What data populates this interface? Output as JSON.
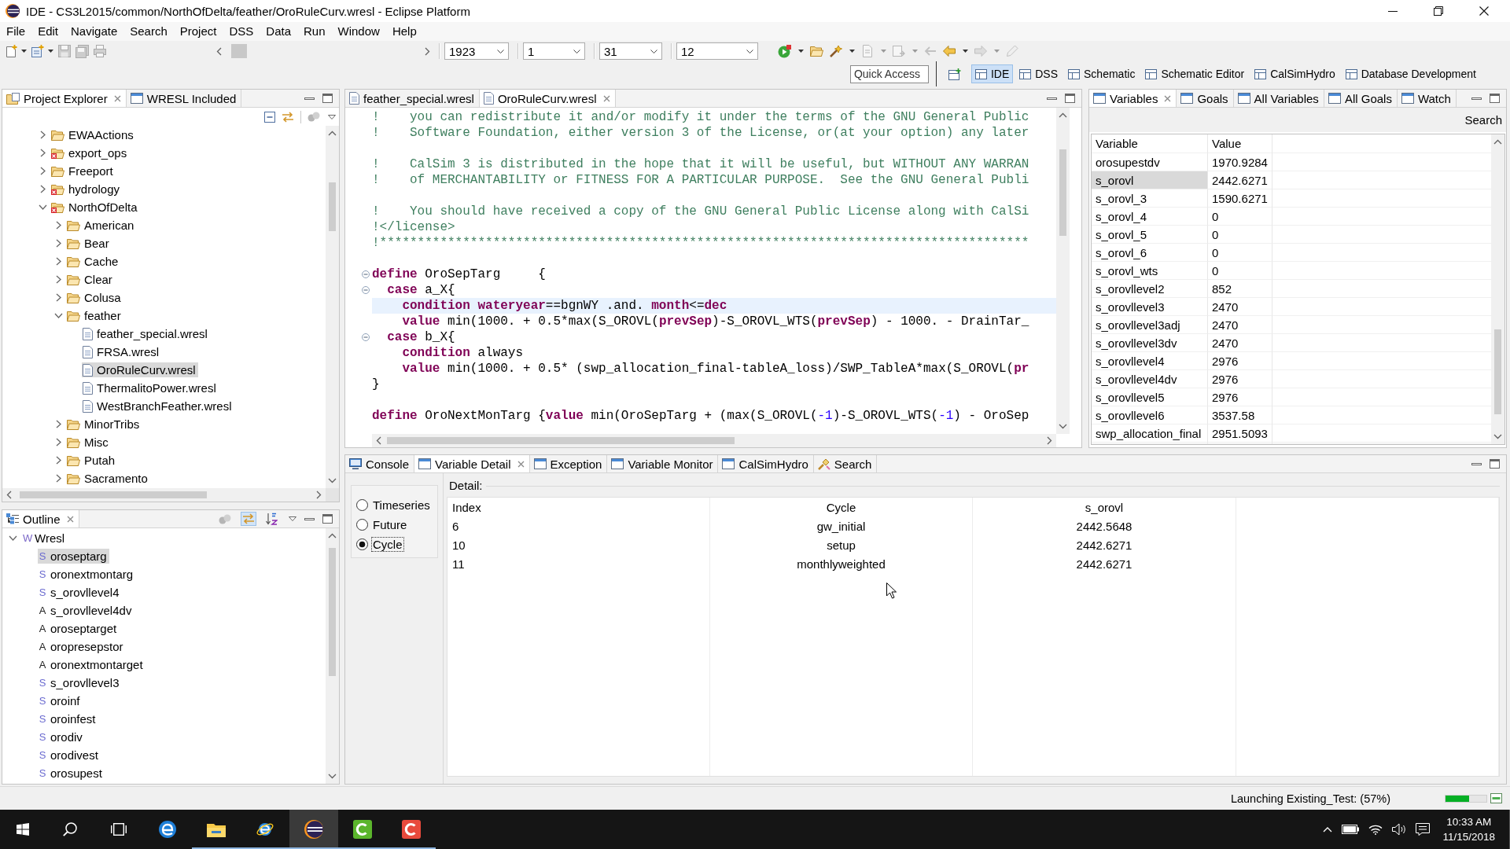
{
  "window": {
    "title": "IDE - CS3L2015/common/NorthOfDelta/feather/OroRuleCurv.wresl - Eclipse Platform"
  },
  "menu_bar": [
    "File",
    "Edit",
    "Navigate",
    "Search",
    "Project",
    "DSS",
    "Data",
    "Run",
    "Window",
    "Help"
  ],
  "toolbar": {
    "left_buttons": [
      {
        "disabled": false,
        "dropdown": true
      },
      {
        "disabled": false,
        "dropdown": true
      },
      {
        "disabled": true,
        "dropdown": false
      },
      {
        "disabled": true,
        "dropdown": false
      },
      {
        "disabled": true,
        "dropdown": false
      }
    ],
    "date_fields": [
      {
        "value": "1923"
      },
      {
        "value": "1"
      },
      {
        "value": "31"
      },
      {
        "value": "12"
      }
    ],
    "right_buttons": [
      {
        "disabled": false,
        "dropdown": true
      },
      {
        "disabled": false,
        "dropdown": false
      },
      {
        "disabled": false,
        "dropdown": true
      },
      {
        "disabled": true,
        "dropdown": true
      },
      {
        "disabled": true,
        "dropdown": true
      },
      {
        "disabled": true,
        "dropdown": false
      },
      {
        "disabled": false,
        "dropdown": true
      },
      {
        "disabled": true,
        "dropdown": true
      },
      {
        "disabled": true,
        "dropdown": false
      }
    ]
  },
  "quick_access": {
    "placeholder": "Quick Access"
  },
  "perspectives": [
    {
      "label": "IDE",
      "selected": true
    },
    {
      "label": "DSS",
      "selected": false
    },
    {
      "label": "Schematic",
      "selected": false
    },
    {
      "label": "Schematic Editor",
      "selected": false
    },
    {
      "label": "CalSimHydro",
      "selected": false
    },
    {
      "label": "Database Development",
      "selected": false
    }
  ],
  "project_explorer": {
    "tabs": [
      {
        "label": "Project Explorer",
        "selected": true
      },
      {
        "label": "WRESL Included",
        "selected": false
      }
    ],
    "tree": [
      {
        "label": "EWAActions",
        "kind": "folder",
        "expanded": false,
        "error": false,
        "selected": false
      },
      {
        "label": "export_ops",
        "kind": "folder",
        "expanded": false,
        "error": true,
        "selected": false
      },
      {
        "label": "Freeport",
        "kind": "folder",
        "expanded": false,
        "error": false,
        "selected": false
      },
      {
        "label": "hydrology",
        "kind": "folder",
        "expanded": false,
        "error": true,
        "selected": false
      },
      {
        "label": "NorthOfDelta",
        "kind": "folder",
        "expanded": true,
        "error": true,
        "selected": false,
        "children": [
          {
            "label": "American",
            "kind": "folder",
            "expanded": false,
            "error": false,
            "selected": false
          },
          {
            "label": "Bear",
            "kind": "folder",
            "expanded": false,
            "error": false,
            "selected": false
          },
          {
            "label": "Cache",
            "kind": "folder",
            "expanded": false,
            "error": false,
            "selected": false
          },
          {
            "label": "Clear",
            "kind": "folder",
            "expanded": false,
            "error": false,
            "selected": false
          },
          {
            "label": "Colusa",
            "kind": "folder",
            "expanded": false,
            "error": false,
            "selected": false
          },
          {
            "label": "feather",
            "kind": "folder",
            "expanded": true,
            "error": false,
            "selected": false,
            "children": [
              {
                "label": "feather_special.wresl",
                "kind": "file",
                "selected": false
              },
              {
                "label": "FRSA.wresl",
                "kind": "file",
                "selected": false
              },
              {
                "label": "OroRuleCurv.wresl",
                "kind": "file",
                "selected": true
              },
              {
                "label": "ThermalitoPower.wresl",
                "kind": "file",
                "selected": false
              },
              {
                "label": "WestBranchFeather.wresl",
                "kind": "file",
                "selected": false
              }
            ]
          },
          {
            "label": "MinorTribs",
            "kind": "folder",
            "expanded": false,
            "error": false,
            "selected": false
          },
          {
            "label": "Misc",
            "kind": "folder",
            "expanded": false,
            "error": false,
            "selected": false
          },
          {
            "label": "Putah",
            "kind": "folder",
            "expanded": false,
            "error": false,
            "selected": false
          },
          {
            "label": "Sacramento",
            "kind": "folder",
            "expanded": false,
            "error": false,
            "selected": false
          }
        ]
      }
    ]
  },
  "outline": {
    "tabs": [
      {
        "label": "Outline",
        "selected": true
      }
    ],
    "tool_buttons": [
      {
        "pressed": false
      },
      {
        "pressed": true
      },
      {
        "pressed": false
      }
    ],
    "tree": [
      {
        "marker": "W",
        "kind": "w",
        "label": "Wresl",
        "expanded": true,
        "selected": false,
        "children": [
          {
            "marker": "S",
            "kind": "s",
            "label": "oroseptarg",
            "selected": true
          },
          {
            "marker": "S",
            "kind": "s",
            "label": "oronextmontarg",
            "selected": false
          },
          {
            "marker": "S",
            "kind": "s",
            "label": "s_orovllevel4",
            "selected": false
          },
          {
            "marker": "A",
            "kind": "a",
            "label": "s_orovllevel4dv",
            "selected": false
          },
          {
            "marker": "A",
            "kind": "a",
            "label": "oroseptarget",
            "selected": false
          },
          {
            "marker": "A",
            "kind": "a",
            "label": "oropresepstor",
            "selected": false
          },
          {
            "marker": "A",
            "kind": "a",
            "label": "oronextmontarget",
            "selected": false
          },
          {
            "marker": "S",
            "kind": "s",
            "label": "s_orovllevel3",
            "selected": false
          },
          {
            "marker": "S",
            "kind": "s",
            "label": "oroinf",
            "selected": false
          },
          {
            "marker": "S",
            "kind": "s",
            "label": "oroinfest",
            "selected": false
          },
          {
            "marker": "S",
            "kind": "s",
            "label": "orodiv",
            "selected": false
          },
          {
            "marker": "S",
            "kind": "s",
            "label": "orodivest",
            "selected": false
          },
          {
            "marker": "S",
            "kind": "s",
            "label": "orosupest",
            "selected": false
          }
        ]
      }
    ]
  },
  "editor": {
    "tabs": [
      {
        "label": "feather_special.wresl",
        "selected": false
      },
      {
        "label": "OroRuleCurv.wresl",
        "selected": true
      }
    ],
    "lines": [
      {
        "fold": false,
        "current": false,
        "tokens": [
          {
            "kind": "comment",
            "text": "!    you can redistribute it and/or modify it under the terms of the GNU General Public"
          }
        ]
      },
      {
        "fold": false,
        "current": false,
        "tokens": [
          {
            "kind": "comment",
            "text": "!    Software Foundation, either version 3 of the License, or(at your option) any later"
          }
        ]
      },
      {
        "fold": false,
        "current": false
      },
      {
        "fold": false,
        "current": false,
        "tokens": [
          {
            "kind": "comment",
            "text": "!    CalSim 3 is distributed in the hope that it will be useful, but WITHOUT ANY WARRAN"
          }
        ]
      },
      {
        "fold": false,
        "current": false,
        "tokens": [
          {
            "kind": "comment",
            "text": "!    of MERCHANTABILITY or FITNESS FOR A PARTICULAR PURPOSE.  See the GNU General Publi"
          }
        ]
      },
      {
        "fold": false,
        "current": false
      },
      {
        "fold": false,
        "current": false,
        "tokens": [
          {
            "kind": "comment",
            "text": "!    You should have received a copy of the GNU General Public License along with CalSi"
          }
        ]
      },
      {
        "fold": false,
        "current": false,
        "tokens": [
          {
            "kind": "comment",
            "text": "!</license>"
          }
        ]
      },
      {
        "fold": false,
        "current": false,
        "tokens": [
          {
            "kind": "comment",
            "text": "!**************************************************************************************"
          }
        ]
      },
      {
        "fold": false,
        "current": false
      },
      {
        "fold": true,
        "current": false,
        "tokens": [
          {
            "kind": "keyword",
            "text": "define"
          },
          {
            "kind": "plain",
            "text": " OroSepTarg     {"
          }
        ]
      },
      {
        "fold": true,
        "current": false,
        "tokens": [
          {
            "kind": "keyword",
            "text": "  case"
          },
          {
            "kind": "plain",
            "text": " a_X{"
          }
        ]
      },
      {
        "fold": false,
        "current": true,
        "tokens": [
          {
            "kind": "keyword",
            "text": "    condition"
          },
          {
            "kind": "keyword",
            "text": " wateryear"
          },
          {
            "kind": "plain",
            "text": "==bgnWY .and. "
          },
          {
            "kind": "keyword",
            "text": "month"
          },
          {
            "kind": "plain",
            "text": "<="
          },
          {
            "kind": "keyword",
            "text": "dec"
          }
        ]
      },
      {
        "fold": false,
        "current": false,
        "tokens": [
          {
            "kind": "keyword",
            "text": "    value"
          },
          {
            "kind": "plain",
            "text": " min(1000. + 0.5*max(S_OROVL("
          },
          {
            "kind": "keyword",
            "text": "prevSep"
          },
          {
            "kind": "plain",
            "text": ")-S_OROVL_WTS("
          },
          {
            "kind": "keyword",
            "text": "prevSep"
          },
          {
            "kind": "plain",
            "text": ") - 1000. - DrainTar_"
          }
        ]
      },
      {
        "fold": true,
        "current": false,
        "tokens": [
          {
            "kind": "keyword",
            "text": "  case"
          },
          {
            "kind": "plain",
            "text": " b_X{"
          }
        ]
      },
      {
        "fold": false,
        "current": false,
        "tokens": [
          {
            "kind": "keyword",
            "text": "    condition"
          },
          {
            "kind": "plain",
            "text": " always"
          }
        ]
      },
      {
        "fold": false,
        "current": false,
        "tokens": [
          {
            "kind": "keyword",
            "text": "    value"
          },
          {
            "kind": "plain",
            "text": " min(1000. + 0.5* (swp_allocation_final-tableA_loss)/SWP_TableA*max(S_OROVL("
          },
          {
            "kind": "keyword",
            "text": "pr"
          }
        ]
      },
      {
        "fold": false,
        "current": false,
        "tokens": [
          {
            "kind": "plain",
            "text": "}"
          }
        ]
      },
      {
        "fold": false,
        "current": false
      },
      {
        "fold": false,
        "current": false,
        "tokens": [
          {
            "kind": "keyword",
            "text": "define"
          },
          {
            "kind": "plain",
            "text": " OroNextMonTarg {"
          },
          {
            "kind": "keyword",
            "text": "value"
          },
          {
            "kind": "plain",
            "text": " min(OroSepTarg + (max(S_OROVL("
          },
          {
            "kind": "number",
            "text": "-1"
          },
          {
            "kind": "plain",
            "text": ")-S_OROVL_WTS("
          },
          {
            "kind": "number",
            "text": "-1"
          },
          {
            "kind": "plain",
            "text": ") - OroSep"
          }
        ]
      }
    ]
  },
  "variables_panel": {
    "tabs": [
      {
        "label": "Variables",
        "selected": true
      },
      {
        "label": "Goals",
        "selected": false
      },
      {
        "label": "All Variables",
        "selected": false
      },
      {
        "label": "All Goals",
        "selected": false
      },
      {
        "label": "Watch",
        "selected": false
      }
    ],
    "search_button": "Search",
    "table": {
      "columns": [
        "Variable",
        "Value"
      ],
      "rows": [
        {
          "variable": "orosupestdv",
          "value": "1970.9284",
          "selected": false
        },
        {
          "variable": "s_orovl",
          "value": "2442.6271",
          "selected": true
        },
        {
          "variable": "s_orovl_3",
          "value": "1590.6271",
          "selected": false
        },
        {
          "variable": "s_orovl_4",
          "value": "0",
          "selected": false
        },
        {
          "variable": "s_orovl_5",
          "value": "0",
          "selected": false
        },
        {
          "variable": "s_orovl_6",
          "value": "0",
          "selected": false
        },
        {
          "variable": "s_orovl_wts",
          "value": "0",
          "selected": false
        },
        {
          "variable": "s_orovllevel2",
          "value": "852",
          "selected": false
        },
        {
          "variable": "s_orovllevel3",
          "value": "2470",
          "selected": false
        },
        {
          "variable": "s_orovllevel3adj",
          "value": "2470",
          "selected": false
        },
        {
          "variable": "s_orovllevel3dv",
          "value": "2470",
          "selected": false
        },
        {
          "variable": "s_orovllevel4",
          "value": "2976",
          "selected": false
        },
        {
          "variable": "s_orovllevel4dv",
          "value": "2976",
          "selected": false
        },
        {
          "variable": "s_orovllevel5",
          "value": "2976",
          "selected": false
        },
        {
          "variable": "s_orovllevel6",
          "value": "3537.58",
          "selected": false
        },
        {
          "variable": "swp_allocation_final",
          "value": "2951.5093",
          "selected": false
        }
      ]
    }
  },
  "bottom_panel": {
    "tabs": [
      {
        "label": "Console",
        "selected": false
      },
      {
        "label": "Variable Detail",
        "selected": true
      },
      {
        "label": "Exception",
        "selected": false
      },
      {
        "label": "Variable Monitor",
        "selected": false
      },
      {
        "label": "CalSimHydro",
        "selected": false
      },
      {
        "label": "Search",
        "selected": false
      }
    ],
    "view_options": [
      {
        "label": "Timeseries",
        "selected": false,
        "focused": false
      },
      {
        "label": "Future",
        "selected": false,
        "focused": false
      },
      {
        "label": "Cycle",
        "selected": true,
        "focused": true
      }
    ],
    "detail": {
      "label": "Detail:",
      "columns": [
        "Index",
        "Cycle",
        "s_orovl"
      ],
      "rows": [
        [
          "6",
          "gw_initial",
          "2442.5648"
        ],
        [
          "10",
          "setup",
          "2442.6271"
        ],
        [
          "11",
          "monthlyweighted",
          "2442.6271"
        ]
      ]
    }
  },
  "status_bar": {
    "message": "Launching Existing_Test: (57%)",
    "progress": {
      "level": 0.57
    }
  },
  "taskbar": {
    "apps": [
      {
        "running": false,
        "active": false
      },
      {
        "running": true,
        "active": false
      },
      {
        "running": true,
        "active": false
      },
      {
        "running": true,
        "active": true
      },
      {
        "running": true,
        "active": false
      },
      {
        "running": true,
        "active": false
      }
    ],
    "clock": {
      "time": "10:33 AM",
      "date": "11/15/2018"
    }
  }
}
